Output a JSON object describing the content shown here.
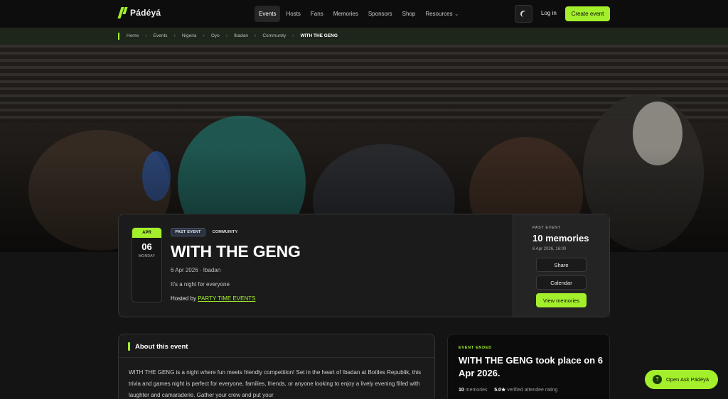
{
  "nav": {
    "logo_text": "Pádéyá",
    "menu": [
      "Events",
      "Hosts",
      "Fans",
      "Memories",
      "Sponsors",
      "Shop",
      "Resources"
    ],
    "resources_chevron": "⌄",
    "login_label": "Log in",
    "create_label": "Create event"
  },
  "breadcrumb": [
    "Home",
    "Events",
    "Nigeria",
    "Oyo",
    "Ibadan",
    "Community",
    "WITH THE GENG"
  ],
  "event": {
    "month": "APR",
    "day": "06",
    "weekday": "MONDAY",
    "tags": [
      "PAST EVENT",
      "COMMUNITY"
    ],
    "title": "WITH THE GENG",
    "meta": "6 Apr 2026 · Ibadan",
    "description": "It's a night for everyone",
    "hosted_by_prefix": "Hosted by",
    "host": "PARTY TIME EVENTS"
  },
  "side": {
    "label": "PAST EVENT",
    "count": "10 memories",
    "datetime": "6 Apr 2026, 16:00",
    "share": "Share",
    "calendar": "Calendar",
    "view": "View memories"
  },
  "about": {
    "title": "About this event",
    "body": "WITH THE GENG is a night where fun meets friendly competition! Set in the heart of Ibadan at Bottles Republik, this trivia and games night is perfect for everyone, families, friends, or anyone looking to enjoy a lively evening filled with laughter and camaraderie. Gather your crew and put your"
  },
  "ended": {
    "label": "EVENT ENDED",
    "title": "WITH THE GENG took place on 6 Apr 2026.",
    "memories_count": "10",
    "memories_label": "memories",
    "rating": "5.0★",
    "rating_label": "verified attendee rating"
  },
  "ask": {
    "icon": "?",
    "label": "Open Ask Pádéyá"
  },
  "colors": {
    "accent": "#a3ef2b",
    "background": "#141414"
  }
}
